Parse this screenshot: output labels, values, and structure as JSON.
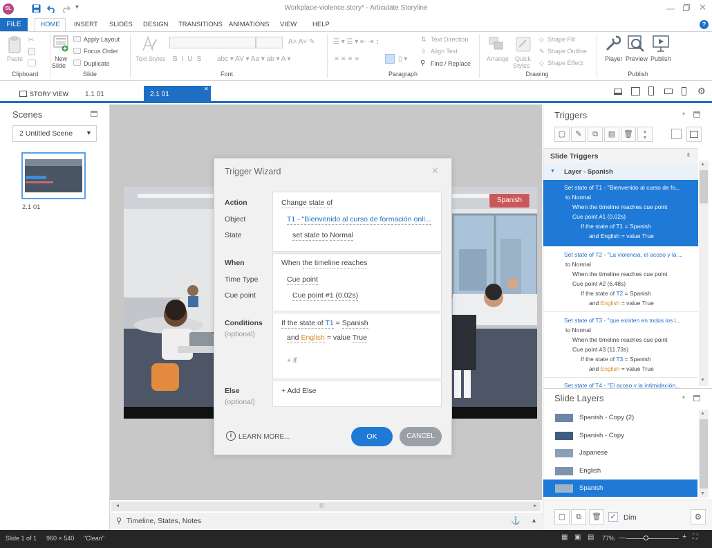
{
  "window": {
    "title": "Workplace-violence.story* - Articulate Storyline",
    "logo": "SL"
  },
  "menu": [
    "FILE",
    "HOME",
    "INSERT",
    "SLIDES",
    "DESIGN",
    "TRANSITIONS",
    "ANIMATIONS",
    "VIEW",
    "HELP"
  ],
  "ribbon": {
    "clipboard": {
      "paste": "Paste",
      "label": "Clipboard"
    },
    "slide": {
      "new_slide": "New",
      "new_slide2": "Slide",
      "apply_layout": "Apply Layout",
      "focus_order": "Focus Order",
      "duplicate": "Duplicate",
      "label": "Slide"
    },
    "font": {
      "text_styles": "Text Styles",
      "label": "Font"
    },
    "paragraph": {
      "text_direction": "Text Direction",
      "align_text": "Align Text",
      "find_replace": "Find / Replace",
      "label": "Paragraph"
    },
    "drawing": {
      "arrange": "Arrange",
      "quick_styles": "Quick",
      "quick_styles2": "Styles",
      "shape_fill": "Shape Fill",
      "shape_outline": "Shape Outline",
      "shape_effect": "Shape Effect",
      "label": "Drawing"
    },
    "publish": {
      "player": "Player",
      "preview": "Preview",
      "publish": "Publish",
      "label": "Publish"
    }
  },
  "tabs": {
    "story_view": "STORY VIEW",
    "tab1": "1.1 01",
    "tab2": "2.1 01"
  },
  "scenes": {
    "title": "Scenes",
    "dropdown": "2 Untitled Scene",
    "slide_label": "2.1 01",
    "thumb_text": "Spanish"
  },
  "slide": {
    "spanish_button": "Spanish"
  },
  "dialog": {
    "title": "Trigger Wizard",
    "action": {
      "label": "Action",
      "value": "Change state of"
    },
    "object": {
      "label": "Object",
      "value": "T1 - \"Bienvenido al curso de formación onli..."
    },
    "state": {
      "label": "State",
      "pre": "set state to",
      "value": "Normal"
    },
    "when": {
      "label": "When",
      "pre": "When",
      "value": "the timeline reaches"
    },
    "time_type": {
      "label": "Time Type",
      "value": "Cue point"
    },
    "cue_point": {
      "label": "Cue point",
      "value": "Cue point #1 (0.02s)"
    },
    "conditions": {
      "label": "Conditions",
      "optional": "(optional)",
      "c1_pre": "If the state of",
      "c1_obj": "T1",
      "c1_eq": "=",
      "c1_val": "Spanish",
      "c2_and": "and",
      "c2_var": "English",
      "c2_eq": "= value",
      "c2_val": "True",
      "add_if": "+ if"
    },
    "else": {
      "label": "Else",
      "optional": "(optional)",
      "add_else": "+ Add Else"
    },
    "learn_more": "LEARN MORE...",
    "ok": "OK",
    "cancel": "CANCEL"
  },
  "triggers": {
    "title": "Triggers",
    "slide_triggers": "Slide Triggers",
    "group": "Layer - Spanish",
    "items": [
      {
        "l1": "Set state of T1 - \"Bienvenido al curso de fo...",
        "l2": "to Normal",
        "l3": "When the timeline reaches cue point",
        "l4": "Cue point #1 (0.02s)",
        "l5a": "If the state of",
        "l5b": "T1",
        "l5c": "= Spanish",
        "l6a": "and",
        "l6b": "English",
        "l6c": "= value True"
      },
      {
        "l1": "Set state of T2 - \"La violencia, el acoso y la ...",
        "l2": "to Normal",
        "l3": "When the timeline reaches cue point",
        "l4": "Cue point #2 (6.48s)",
        "l5a": "If the state of",
        "l5b": "T2",
        "l5c": "= Spanish",
        "l6a": "and",
        "l6b": "English",
        "l6c": "= value True"
      },
      {
        "l1": "Set state of T3 - \"que existen en todos los l...",
        "l2": "to Normal",
        "l3": "When the timeline reaches cue point",
        "l4": "Cue point #3 (11.73s)",
        "l5a": "If the state of",
        "l5b": "T3",
        "l5c": "= Spanish",
        "l6a": "and",
        "l6b": "English",
        "l6c": "= value True"
      }
    ],
    "partial": "Set state of T4 - \"El acoso y la intimidación..."
  },
  "layers": {
    "title": "Slide Layers",
    "items": [
      "Spanish - Copy (2)",
      "Spanish - Copy",
      "Japanese",
      "English",
      "Spanish"
    ],
    "dim": "Dim"
  },
  "bottom": {
    "timeline": "Timeline, States, Notes"
  },
  "status": {
    "slide": "Slide 1 of 1",
    "size": "960 × 540",
    "state": "\"Clean\"",
    "zoom": "77%"
  }
}
